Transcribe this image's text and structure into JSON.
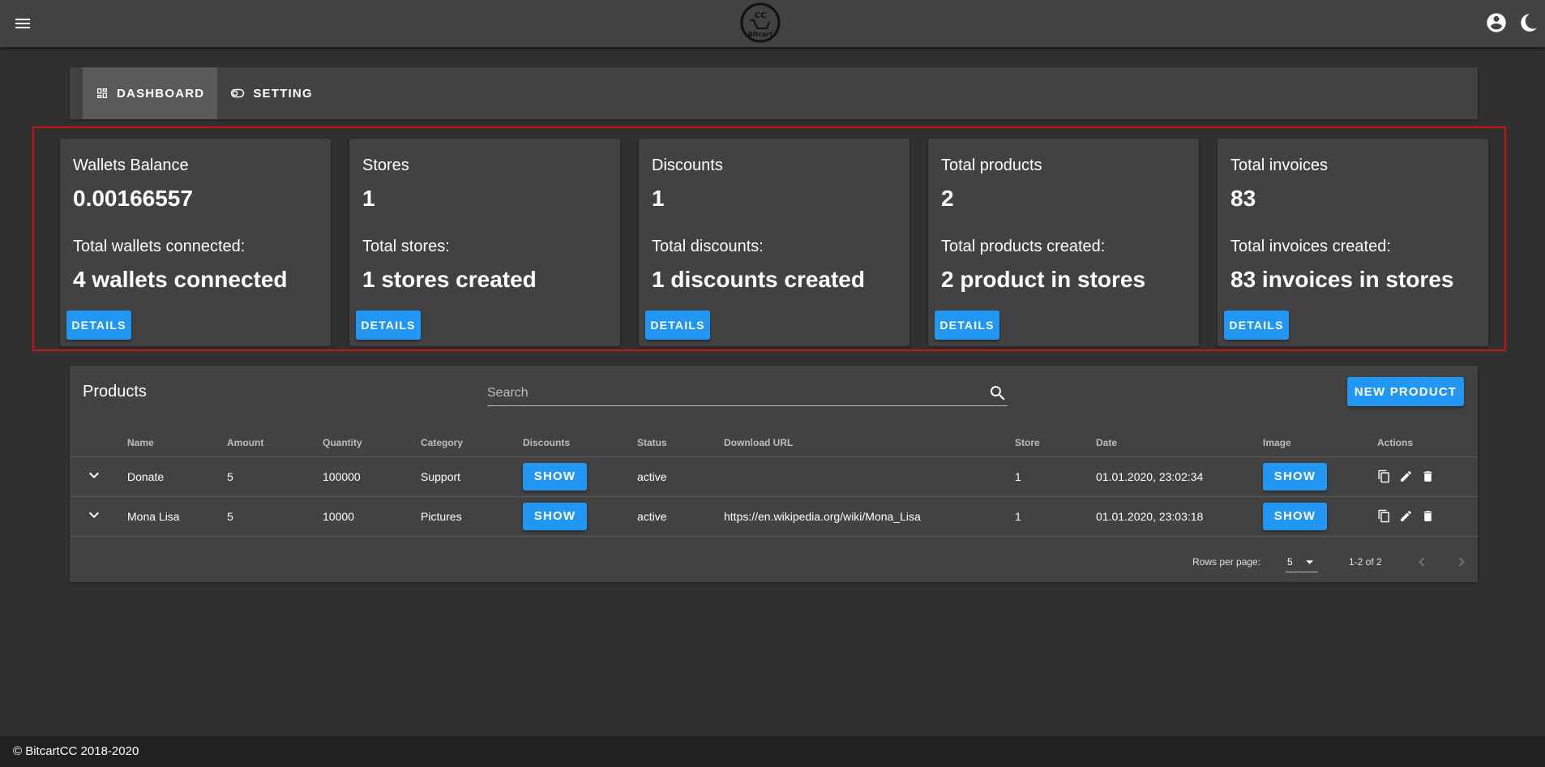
{
  "header": {
    "logo_text": "BitcartCC"
  },
  "tabs": [
    {
      "label": "DASHBOARD"
    },
    {
      "label": "SETTING"
    }
  ],
  "stats": [
    {
      "title": "Wallets Balance",
      "value": "0.00166557",
      "subtitle": "Total wallets connected:",
      "subvalue": "4 wallets connected",
      "button": "DETAILS"
    },
    {
      "title": "Stores",
      "value": "1",
      "subtitle": "Total stores:",
      "subvalue": "1 stores created",
      "button": "DETAILS"
    },
    {
      "title": "Discounts",
      "value": "1",
      "subtitle": "Total discounts:",
      "subvalue": "1 discounts created",
      "button": "DETAILS"
    },
    {
      "title": "Total products",
      "value": "2",
      "subtitle": "Total products created:",
      "subvalue": "2 product in stores",
      "button": "DETAILS"
    },
    {
      "title": "Total invoices",
      "value": "83",
      "subtitle": "Total invoices created:",
      "subvalue": "83 invoices in stores",
      "button": "DETAILS"
    }
  ],
  "products": {
    "title": "Products",
    "search_placeholder": "Search",
    "new_button": "NEW PRODUCT",
    "columns": [
      "Name",
      "Amount",
      "Quantity",
      "Category",
      "Discounts",
      "Status",
      "Download URL",
      "Store",
      "Date",
      "Image",
      "Actions"
    ],
    "rows": [
      {
        "name": "Donate",
        "amount": "5",
        "quantity": "100000",
        "category": "Support",
        "discounts": "SHOW",
        "status": "active",
        "download_url": "",
        "store": "1",
        "date": "01.01.2020, 23:02:34",
        "image": "SHOW"
      },
      {
        "name": "Mona Lisa",
        "amount": "5",
        "quantity": "10000",
        "category": "Pictures",
        "discounts": "SHOW",
        "status": "active",
        "download_url": "https://en.wikipedia.org/wiki/Mona_Lisa",
        "store": "1",
        "date": "01.01.2020, 23:03:18",
        "image": "SHOW"
      }
    ],
    "rows_per_page_label": "Rows per page:",
    "rows_per_page_value": "5",
    "range_text": "1-2 of 2"
  },
  "footer": {
    "copyright": "© BitcartCC 2018-2020"
  }
}
